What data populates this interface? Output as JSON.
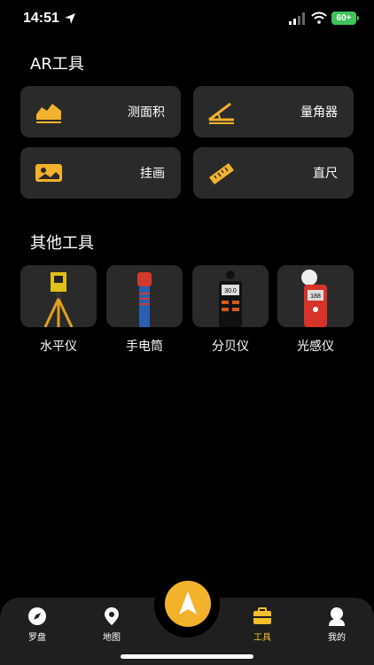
{
  "status": {
    "time": "14:51",
    "battery": "60+"
  },
  "ar_section": {
    "title": "AR工具",
    "items": [
      {
        "label": "测面积",
        "icon": "area-icon"
      },
      {
        "label": "量角器",
        "icon": "protractor-icon"
      },
      {
        "label": "挂画",
        "icon": "picture-icon"
      },
      {
        "label": "直尺",
        "icon": "ruler-icon"
      }
    ]
  },
  "other_section": {
    "title": "其他工具",
    "items": [
      {
        "label": "水平仪",
        "icon": "level-instrument-image"
      },
      {
        "label": "手电筒",
        "icon": "flashlight-image"
      },
      {
        "label": "分贝仪",
        "icon": "decibel-meter-image",
        "display": "30.0"
      },
      {
        "label": "光感仪",
        "icon": "light-meter-image",
        "display": "188"
      }
    ]
  },
  "tabbar": {
    "items": [
      {
        "label": "罗盘",
        "icon": "compass-icon"
      },
      {
        "label": "地图",
        "icon": "map-pin-icon"
      },
      {
        "label": "工具",
        "icon": "toolbox-icon",
        "active": true
      },
      {
        "label": "我的",
        "icon": "profile-icon"
      }
    ],
    "center_icon": "navigation-arrow-icon"
  },
  "colors": {
    "accent": "#f2b22c",
    "active_tab": "#f2c12b",
    "card": "#2a2a2a",
    "tabbar": "#1f1f1f"
  }
}
